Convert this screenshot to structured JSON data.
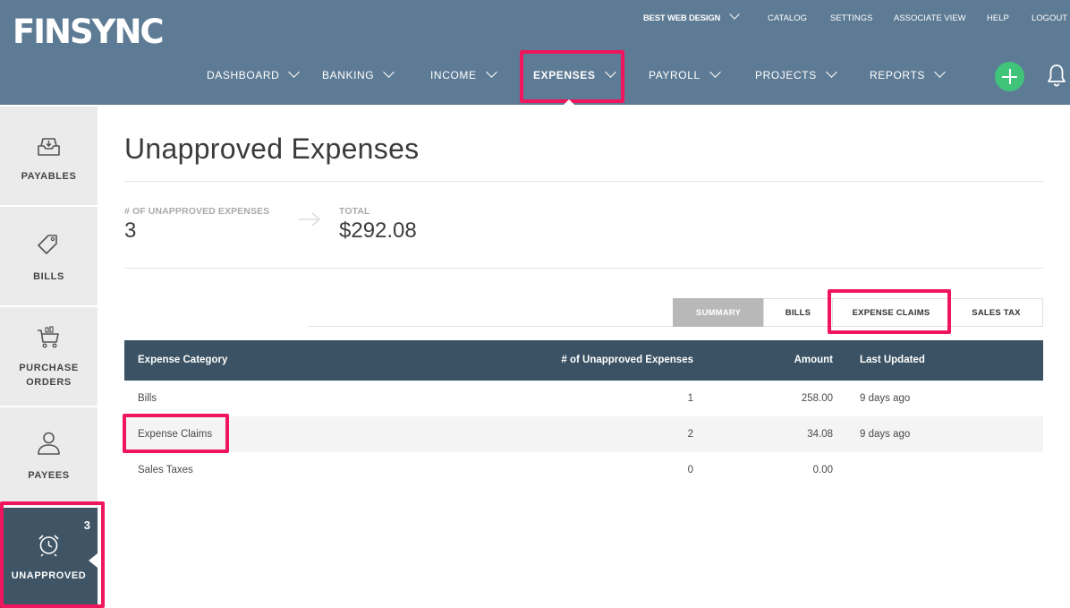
{
  "header": {
    "logo": "FINSYNC",
    "company": "BEST WEB DESIGN",
    "util_links": [
      "CATALOG",
      "SETTINGS",
      "ASSOCIATE VIEW",
      "HELP",
      "LOGOUT"
    ],
    "nav": [
      "DASHBOARD",
      "BANKING",
      "INCOME",
      "EXPENSES",
      "PAYROLL",
      "PROJECTS",
      "REPORTS"
    ],
    "active_nav": "EXPENSES",
    "colors": {
      "bar": "#5e7b95",
      "add_button": "#3fc47a",
      "highlight": "#f0165e"
    },
    "icons": [
      "chevron-down-icon",
      "plus-icon",
      "bell-icon"
    ]
  },
  "sidebar": {
    "items": [
      {
        "label": "PAYABLES",
        "icon": "inbox-tray-icon"
      },
      {
        "label": "BILLS",
        "icon": "price-tag-icon"
      },
      {
        "label": "PURCHASE ORDERS",
        "label_lines": [
          "PURCHASE",
          "ORDERS"
        ],
        "icon": "shopping-cart-icon"
      },
      {
        "label": "PAYEES",
        "icon": "person-icon"
      },
      {
        "label": "UNAPPROVED",
        "icon": "alarm-clock-icon",
        "badge": "3",
        "active": true
      }
    ]
  },
  "main": {
    "title": "Unapproved Expenses",
    "stats": {
      "count_label": "# OF UNAPPROVED EXPENSES",
      "count_value": "3",
      "total_label": "TOTAL",
      "total_value": "$292.08"
    },
    "tabs": [
      {
        "label": "SUMMARY",
        "active": true
      },
      {
        "label": "BILLS"
      },
      {
        "label": "EXPENSE CLAIMS"
      },
      {
        "label": "SALES TAX"
      }
    ],
    "table": {
      "columns": [
        "Expense Category",
        "# of Unapproved Expenses",
        "Amount",
        "Last Updated"
      ],
      "rows": [
        {
          "category": "Bills",
          "count": "1",
          "amount": "258.00",
          "updated": "9 days ago"
        },
        {
          "category": "Expense Claims",
          "count": "2",
          "amount": "34.08",
          "updated": "9 days ago"
        },
        {
          "category": "Sales Taxes",
          "count": "0",
          "amount": "0.00",
          "updated": ""
        }
      ]
    }
  }
}
